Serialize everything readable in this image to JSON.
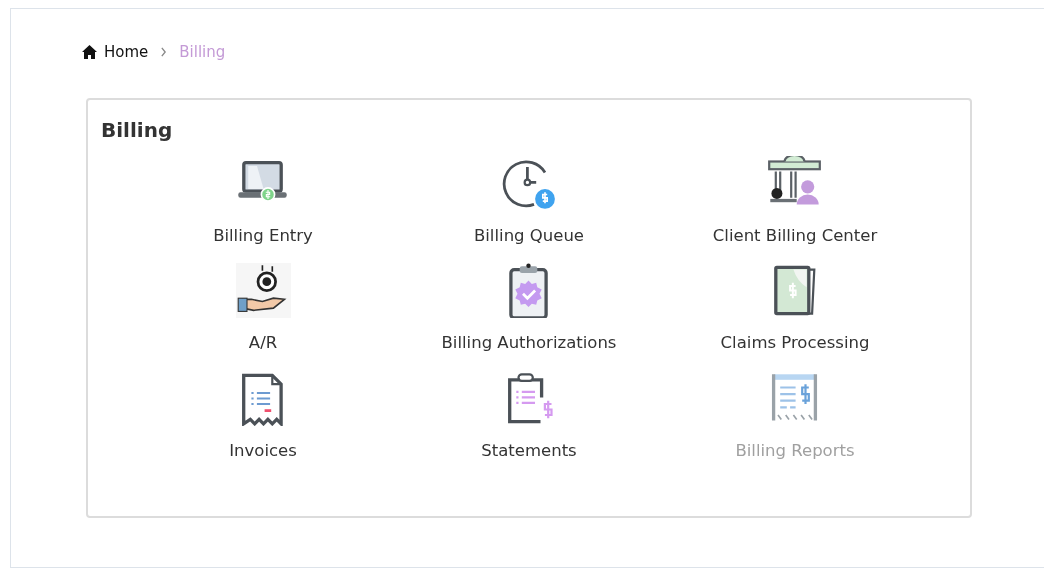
{
  "breadcrumb": [
    {
      "label": "Home",
      "kind": "home",
      "current": false
    },
    {
      "label": "Billing",
      "kind": "page",
      "current": true
    }
  ],
  "panel": {
    "title": "Billing",
    "items": [
      {
        "label": "Billing Entry",
        "kind": "laptop",
        "disabled": false
      },
      {
        "label": "Billing Queue",
        "kind": "clock",
        "disabled": false
      },
      {
        "label": "Client Billing Center",
        "kind": "bank",
        "disabled": false
      },
      {
        "label": "A/R",
        "kind": "hand",
        "disabled": false
      },
      {
        "label": "Billing Authorizations",
        "kind": "clipboard-check",
        "disabled": false
      },
      {
        "label": "Claims Processing",
        "kind": "bills",
        "disabled": false
      },
      {
        "label": "Invoices",
        "kind": "receipt",
        "disabled": false
      },
      {
        "label": "Statements",
        "kind": "clipboard-list",
        "disabled": false
      },
      {
        "label": "Billing Reports",
        "kind": "report",
        "disabled": true
      }
    ]
  }
}
